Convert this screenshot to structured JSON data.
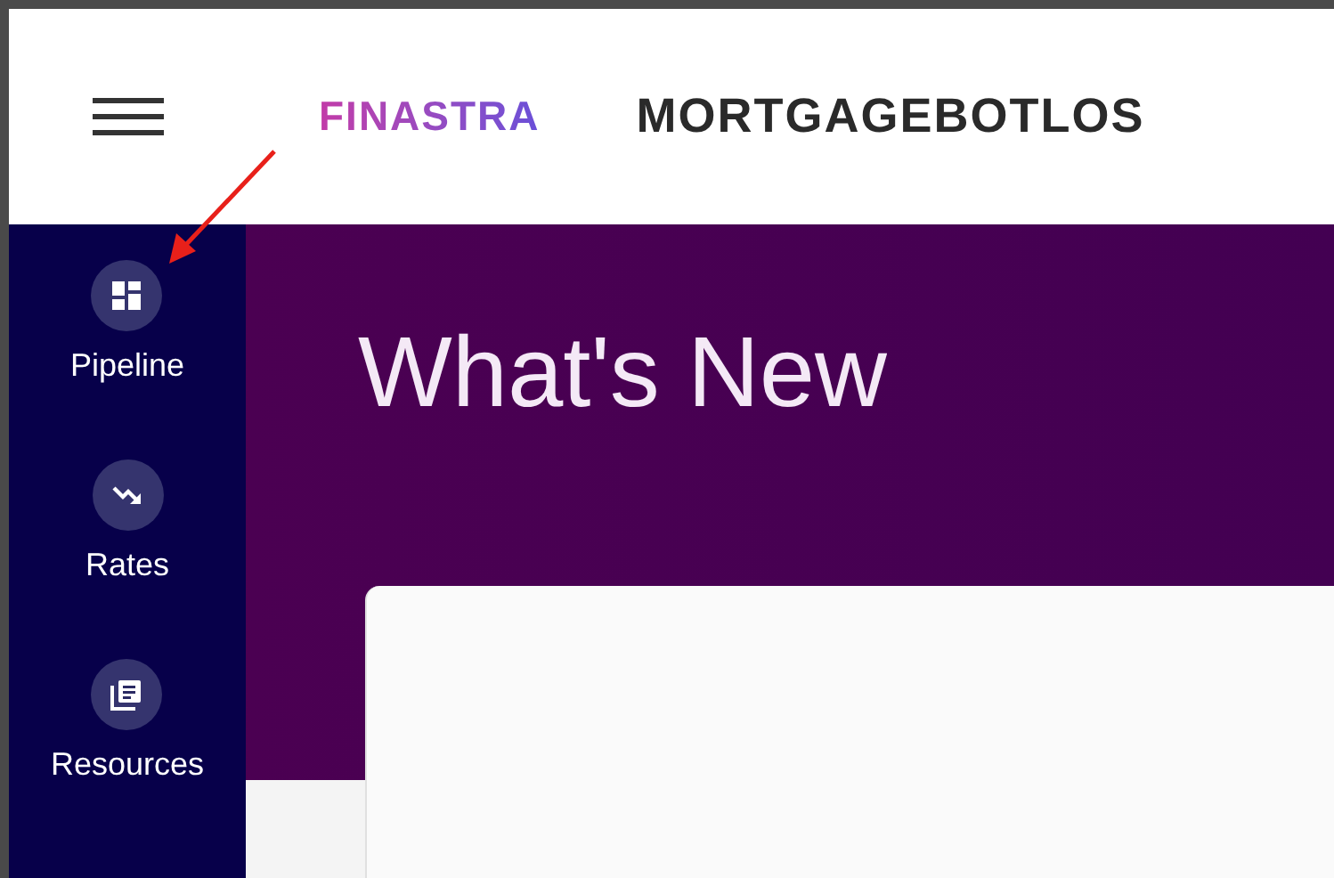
{
  "header": {
    "logo": "FINASTRA",
    "app_title": "MORTGAGEBOTLOS"
  },
  "sidebar": {
    "items": [
      {
        "label": "Pipeline",
        "kind": "grid"
      },
      {
        "label": "Rates",
        "kind": "trend"
      },
      {
        "label": "Resources",
        "kind": "library"
      }
    ]
  },
  "main": {
    "heading": "What's New"
  }
}
